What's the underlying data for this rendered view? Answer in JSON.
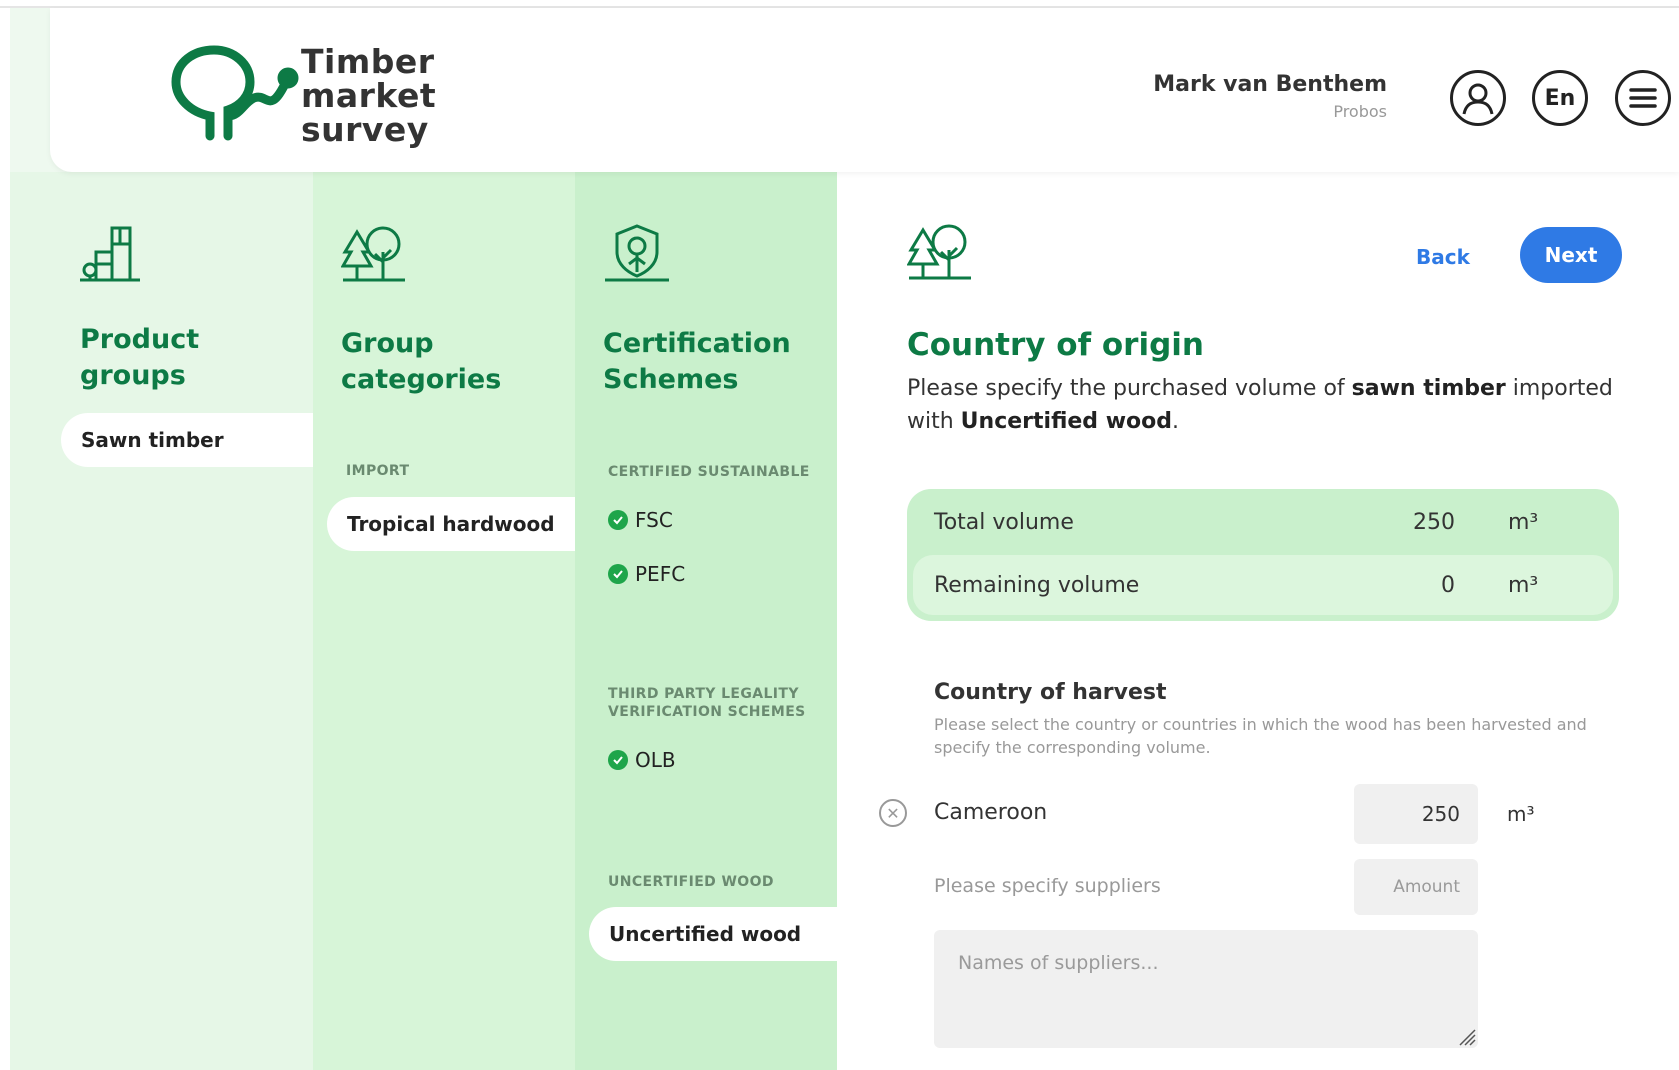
{
  "app": {
    "logo_text_line1": "Timber",
    "logo_text_line2": "market",
    "logo_text_line3": "survey"
  },
  "user": {
    "name": "Mark van Benthem",
    "org": "Probos",
    "language": "En"
  },
  "columns": {
    "product_groups": {
      "title_line1": "Product",
      "title_line2": "groups",
      "selected": "Sawn timber"
    },
    "group_categories": {
      "title_line1": "Group",
      "title_line2": "categories",
      "section": "IMPORT",
      "selected": "Tropical hardwood"
    },
    "certification": {
      "title_line1": "Certification",
      "title_line2": "Schemes",
      "sec_certified": "CERTIFIED SUSTAINABLE",
      "certified_items": [
        "FSC",
        "PEFC"
      ],
      "sec_third_line1": "THIRD PARTY LEGALITY",
      "sec_third_line2": "VERIFICATION SCHEMES",
      "third_items": [
        "OLB"
      ],
      "sec_uncertified": "UNCERTIFIED WOOD",
      "selected": "Uncertified wood"
    }
  },
  "main": {
    "back_label": "Back",
    "next_label": "Next",
    "title": "Country of origin",
    "desc_part1": "Please specify the purchased volume of ",
    "desc_bold1": "sawn timber",
    "desc_part2": " imported with ",
    "desc_bold2": "Uncertified wood",
    "desc_part3": ".",
    "total_label": "Total volume",
    "total_value": "250",
    "remaining_label": "Remaining volume",
    "remaining_value": "0",
    "unit": "m³",
    "harvest_title": "Country of harvest",
    "harvest_desc": "Please select the country or countries in which the wood has been harvested and specify the corresponding volume.",
    "country": "Cameroon",
    "country_amount": "250",
    "suppliers_label": "Please specify suppliers",
    "amount_placeholder": "Amount",
    "names_placeholder": "Names of suppliers..."
  },
  "colors": {
    "brand_green": "#0d7a45",
    "accent_blue": "#2f7ae5",
    "check_green": "#1ea54a"
  }
}
